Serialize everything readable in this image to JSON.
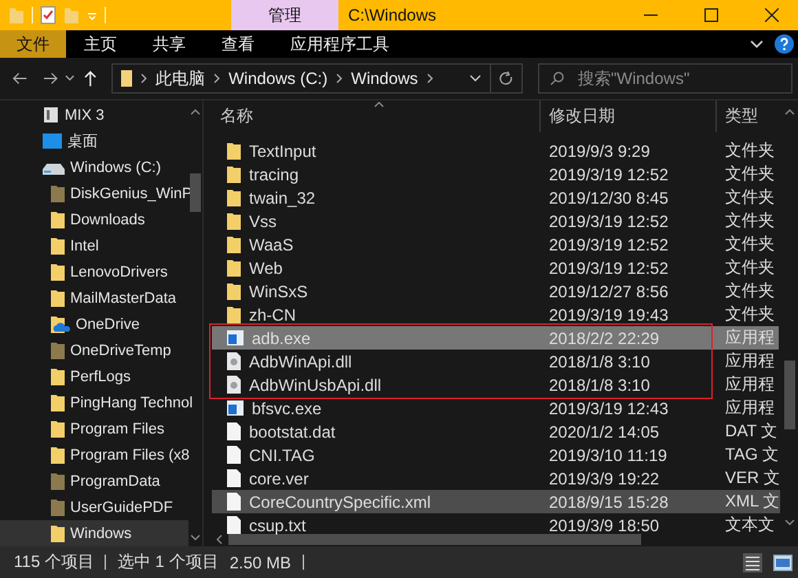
{
  "window": {
    "title": "C:\\Windows",
    "context_tab": "管理"
  },
  "ribbon_tabs": [
    {
      "label": "文件",
      "selected": true
    },
    {
      "label": "主页",
      "selected": false
    },
    {
      "label": "共享",
      "selected": false
    },
    {
      "label": "查看",
      "selected": false
    },
    {
      "label": "应用程序工具",
      "selected": false
    }
  ],
  "address": {
    "crumbs": [
      "此电脑",
      "Windows (C:)",
      "Windows"
    ]
  },
  "search": {
    "placeholder": "搜索\"Windows\""
  },
  "sidebar": {
    "items": [
      {
        "label": "MIX 3",
        "kind": "pc",
        "selected": false
      },
      {
        "label": "桌面",
        "kind": "desktop",
        "selected": false
      },
      {
        "label": "Windows (C:)",
        "kind": "drive",
        "selected": false,
        "children": [
          {
            "label": "DiskGenius_WinP",
            "kind": "folder",
            "hidden": true,
            "selected": false
          },
          {
            "label": "Downloads",
            "kind": "folder",
            "hidden": false,
            "selected": false
          },
          {
            "label": "Intel",
            "kind": "folder",
            "hidden": false,
            "selected": false
          },
          {
            "label": "LenovoDrivers",
            "kind": "folder",
            "hidden": false,
            "selected": false
          },
          {
            "label": "MailMasterData",
            "kind": "folder",
            "hidden": false,
            "selected": false
          },
          {
            "label": "OneDrive",
            "kind": "onedrive",
            "hidden": false,
            "selected": false
          },
          {
            "label": "OneDriveTemp",
            "kind": "folder",
            "hidden": true,
            "selected": false
          },
          {
            "label": "PerfLogs",
            "kind": "folder",
            "hidden": false,
            "selected": false
          },
          {
            "label": "PingHang Technol",
            "kind": "folder",
            "hidden": false,
            "selected": false
          },
          {
            "label": "Program Files",
            "kind": "folder",
            "hidden": false,
            "selected": false
          },
          {
            "label": "Program Files (x8",
            "kind": "folder",
            "hidden": false,
            "selected": false
          },
          {
            "label": "ProgramData",
            "kind": "folder",
            "hidden": true,
            "selected": false
          },
          {
            "label": "UserGuidePDF",
            "kind": "folder",
            "hidden": true,
            "selected": false
          },
          {
            "label": "Windows",
            "kind": "folder",
            "hidden": false,
            "selected": true
          }
        ]
      }
    ]
  },
  "table": {
    "columns": [
      "名称",
      "修改日期",
      "类型"
    ],
    "rows": [
      {
        "name": "TextInput",
        "date": "2019/9/3 9:29",
        "type": "文件夹",
        "kind": "folder",
        "selected": false,
        "hovered": false,
        "marked": false
      },
      {
        "name": "tracing",
        "date": "2019/3/19 12:52",
        "type": "文件夹",
        "kind": "folder",
        "selected": false,
        "hovered": false,
        "marked": false
      },
      {
        "name": "twain_32",
        "date": "2019/12/30 8:45",
        "type": "文件夹",
        "kind": "folder",
        "selected": false,
        "hovered": false,
        "marked": false
      },
      {
        "name": "Vss",
        "date": "2019/3/19 12:52",
        "type": "文件夹",
        "kind": "folder",
        "selected": false,
        "hovered": false,
        "marked": false
      },
      {
        "name": "WaaS",
        "date": "2019/3/19 12:52",
        "type": "文件夹",
        "kind": "folder",
        "selected": false,
        "hovered": false,
        "marked": false
      },
      {
        "name": "Web",
        "date": "2019/3/19 12:52",
        "type": "文件夹",
        "kind": "folder",
        "selected": false,
        "hovered": false,
        "marked": false
      },
      {
        "name": "WinSxS",
        "date": "2019/12/27 8:56",
        "type": "文件夹",
        "kind": "folder",
        "selected": false,
        "hovered": false,
        "marked": false
      },
      {
        "name": "zh-CN",
        "date": "2019/3/19 19:43",
        "type": "文件夹",
        "kind": "folder",
        "selected": false,
        "hovered": false,
        "marked": false
      },
      {
        "name": "adb.exe",
        "date": "2018/2/2 22:29",
        "type": "应用程",
        "kind": "exe",
        "selected": true,
        "hovered": false,
        "marked": true
      },
      {
        "name": "AdbWinApi.dll",
        "date": "2018/1/8 3:10",
        "type": "应用程",
        "kind": "dll",
        "selected": false,
        "hovered": false,
        "marked": true
      },
      {
        "name": "AdbWinUsbApi.dll",
        "date": "2018/1/8 3:10",
        "type": "应用程",
        "kind": "dll",
        "selected": false,
        "hovered": false,
        "marked": true
      },
      {
        "name": "bfsvc.exe",
        "date": "2019/3/19 12:43",
        "type": "应用程",
        "kind": "exe",
        "selected": false,
        "hovered": false,
        "marked": false
      },
      {
        "name": "bootstat.dat",
        "date": "2020/1/2 14:05",
        "type": "DAT 文",
        "kind": "file",
        "selected": false,
        "hovered": false,
        "marked": false
      },
      {
        "name": "CNI.TAG",
        "date": "2019/3/10 11:19",
        "type": "TAG 文",
        "kind": "file",
        "selected": false,
        "hovered": false,
        "marked": false
      },
      {
        "name": "core.ver",
        "date": "2019/3/9 19:22",
        "type": "VER 文",
        "kind": "file",
        "selected": false,
        "hovered": false,
        "marked": false
      },
      {
        "name": "CoreCountrySpecific.xml",
        "date": "2018/9/15 15:28",
        "type": "XML 文",
        "kind": "file",
        "selected": false,
        "hovered": true,
        "marked": false
      },
      {
        "name": "csup.txt",
        "date": "2019/3/9 18:50",
        "type": "文本文",
        "kind": "file",
        "selected": false,
        "hovered": false,
        "marked": false
      }
    ]
  },
  "status_bar": {
    "count": "115 个项目",
    "selection": "选中 1 个项目",
    "size": "2.50 MB"
  }
}
